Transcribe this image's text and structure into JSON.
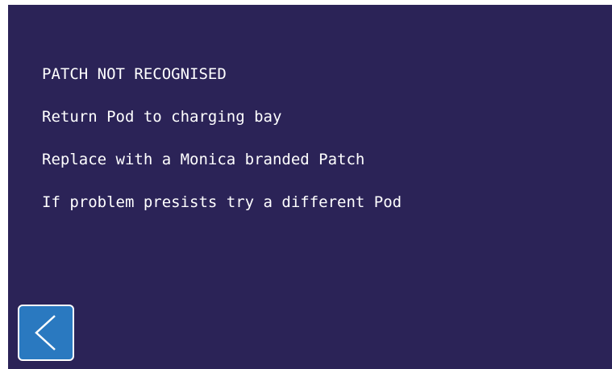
{
  "message": {
    "title": "PATCH NOT RECOGNISED",
    "lines": [
      "Return Pod to charging bay",
      "Replace with a Monica branded Patch",
      "If problem presists try a different Pod"
    ]
  },
  "back_button": {
    "icon": "chevron-left-icon"
  },
  "colors": {
    "background": "#2b2357",
    "text": "#ffffff",
    "button_fill": "#2a79c0",
    "button_border": "#ffffff"
  }
}
